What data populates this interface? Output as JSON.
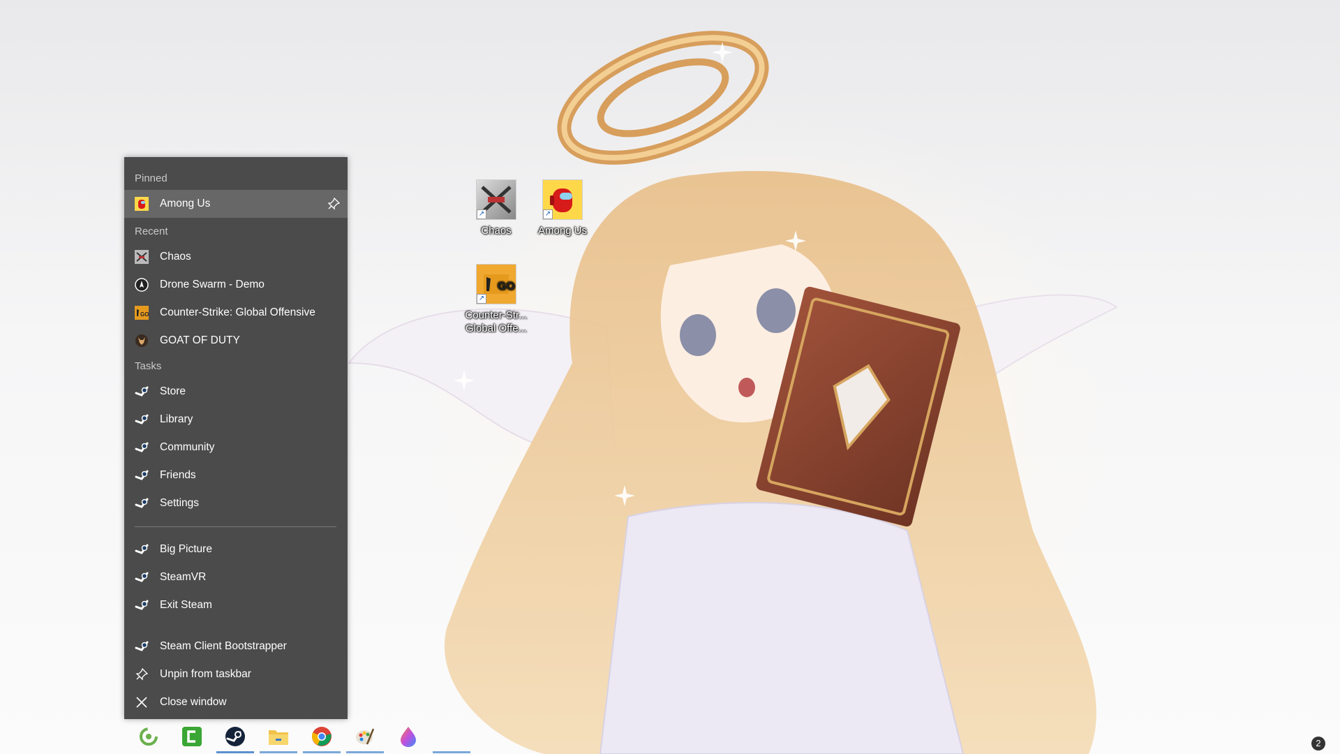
{
  "desktop": {
    "icons": [
      {
        "label": "Chaos"
      },
      {
        "label": "Among Us"
      },
      {
        "label_line1": "Counter-Str...",
        "label_line2": "Global Offe..."
      }
    ]
  },
  "jumplist": {
    "pinned_header": "Pinned",
    "pinned": [
      {
        "label": "Among Us",
        "icon": "among-us-icon"
      }
    ],
    "recent_header": "Recent",
    "recent": [
      {
        "label": "Chaos",
        "icon": "chaos-icon"
      },
      {
        "label": "Drone Swarm - Demo",
        "icon": "drone-swarm-icon"
      },
      {
        "label": "Counter-Strike: Global Offensive",
        "icon": "csgo-icon"
      },
      {
        "label": "GOAT OF DUTY",
        "icon": "goat-of-duty-icon"
      }
    ],
    "tasks_header": "Tasks",
    "tasks": [
      {
        "label": "Store",
        "icon": "steam-icon"
      },
      {
        "label": "Library",
        "icon": "steam-icon"
      },
      {
        "label": "Community",
        "icon": "steam-icon"
      },
      {
        "label": "Friends",
        "icon": "steam-icon"
      },
      {
        "label": "Settings",
        "icon": "steam-icon"
      }
    ],
    "tasks2": [
      {
        "label": "Big Picture",
        "icon": "steam-icon"
      },
      {
        "label": "SteamVR",
        "icon": "steam-icon"
      },
      {
        "label": "Exit Steam",
        "icon": "steam-icon"
      }
    ],
    "app_actions": [
      {
        "label": "Steam Client Bootstrapper",
        "icon": "steam-icon"
      },
      {
        "label": "Unpin from taskbar",
        "icon": "unpin-icon"
      },
      {
        "label": "Close window",
        "icon": "close-icon"
      }
    ]
  },
  "taskbar": {
    "apps": [
      {
        "icon": "green-swirl-app-icon"
      },
      {
        "icon": "camtasia-icon"
      },
      {
        "icon": "steam-icon"
      },
      {
        "icon": "file-explorer-icon"
      },
      {
        "icon": "chrome-icon"
      },
      {
        "icon": "paint-icon"
      },
      {
        "icon": "droplet-app-icon"
      },
      {
        "icon": "blank-app-icon"
      }
    ],
    "notification_count": "2"
  },
  "colors": {
    "jumplist_bg": "#4b4b4b",
    "jumplist_hover": "#676767",
    "taskbar_underline": "#7aa7d9"
  }
}
